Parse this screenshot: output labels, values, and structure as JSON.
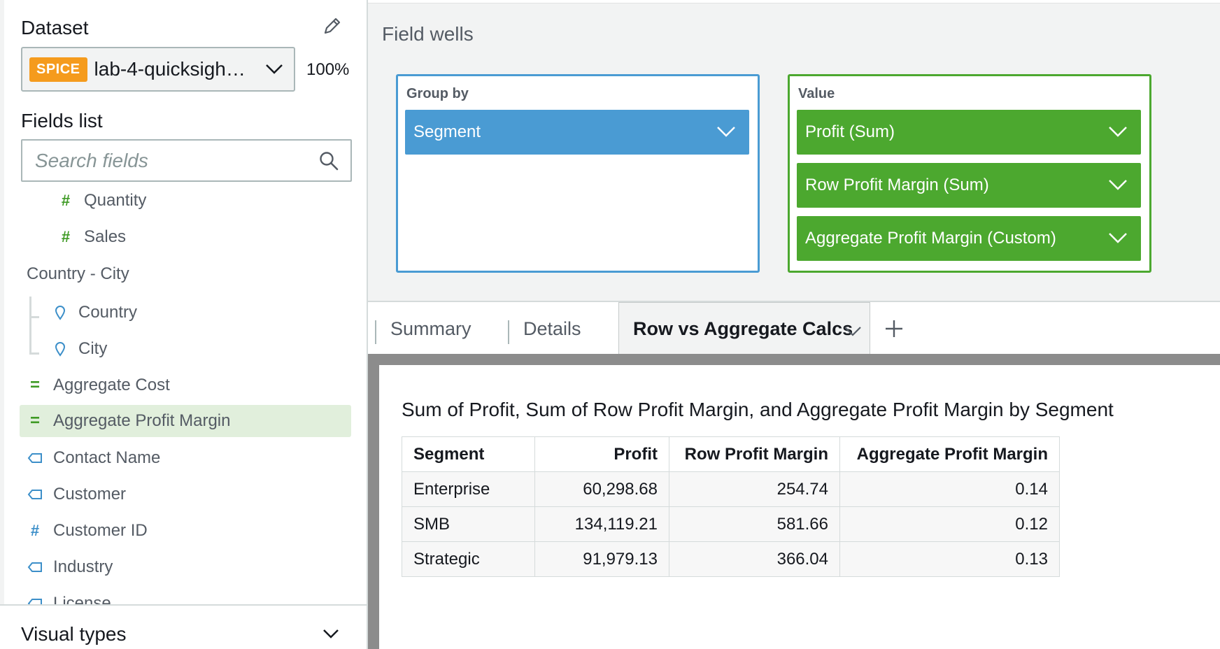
{
  "dataset": {
    "header": "Dataset",
    "badge": "SPICE",
    "name": "lab-4-quicksigh…",
    "spice_usage": "100%"
  },
  "fields_list": {
    "title": "Fields list",
    "search_placeholder": "Search fields",
    "items": [
      {
        "label": "Quantity",
        "icon": "measure-hash-icon"
      },
      {
        "label": "Sales",
        "icon": "measure-hash-icon"
      },
      {
        "label": "Country - City",
        "icon": "hierarchy-group"
      },
      {
        "label": "Country",
        "icon": "geo-pin-icon"
      },
      {
        "label": "City",
        "icon": "geo-pin-icon"
      },
      {
        "label": "Aggregate Cost",
        "icon": "calculated-field-icon"
      },
      {
        "label": "Aggregate Profit Margin",
        "icon": "calculated-field-icon",
        "selected": true
      },
      {
        "label": "Contact Name",
        "icon": "dimension-tag-icon"
      },
      {
        "label": "Customer",
        "icon": "dimension-tag-icon"
      },
      {
        "label": "Customer ID",
        "icon": "dimension-hash-icon"
      },
      {
        "label": "Industry",
        "icon": "dimension-tag-icon"
      },
      {
        "label": "License",
        "icon": "dimension-tag-icon"
      }
    ]
  },
  "visual_types": {
    "label": "Visual types"
  },
  "field_wells": {
    "title": "Field wells",
    "group_by": {
      "label": "Group by",
      "fields": [
        "Segment"
      ]
    },
    "value": {
      "label": "Value",
      "fields": [
        "Profit (Sum)",
        "Row Profit Margin (Sum)",
        "Aggregate Profit Margin (Custom)"
      ]
    }
  },
  "tabs": [
    "Summary",
    "Details",
    "Row vs Aggregate Calcs"
  ],
  "visual": {
    "title": "Sum of Profit, Sum of Row Profit Margin, and Aggregate Profit Margin by Segment",
    "columns": [
      "Segment",
      "Profit",
      "Row Profit Margin",
      "Aggregate Profit Margin"
    ],
    "rows": [
      [
        "Enterprise",
        "60,298.68",
        "254.74",
        "0.14"
      ],
      [
        "SMB",
        "134,119.21",
        "581.66",
        "0.12"
      ],
      [
        "Strategic",
        "91,979.13",
        "366.04",
        "0.13"
      ]
    ]
  },
  "colors": {
    "spice_badge": "#f59b1d",
    "group_by_well": "#4a9bd3",
    "value_well": "#4ca82f",
    "selected_field_bg": "#e1efdc"
  }
}
